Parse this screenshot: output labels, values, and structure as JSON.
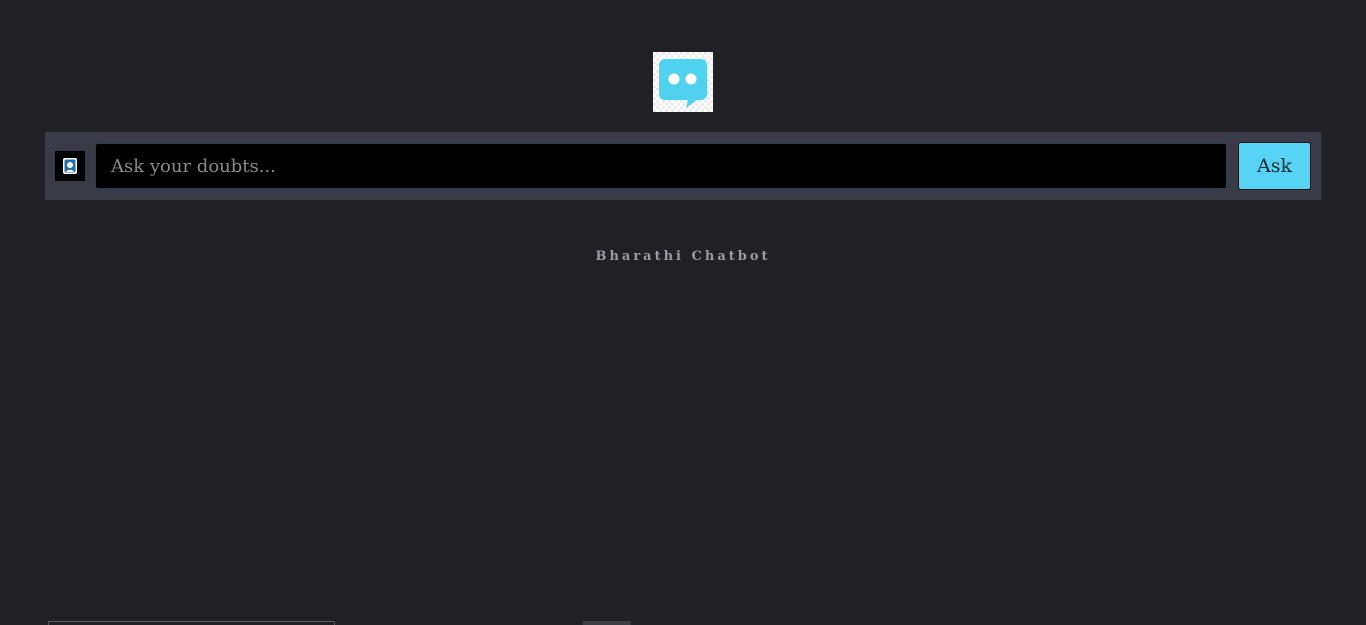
{
  "header": {
    "logo_icon": "chat-bubble-icon"
  },
  "search": {
    "avatar_icon": "user-avatar-icon",
    "placeholder": "Ask your doubts...",
    "value": "",
    "ask_label": "Ask"
  },
  "footer": {
    "tagline": "Bharathi Chatbot"
  },
  "colors": {
    "background": "#202025",
    "bar": "#3b3b48",
    "accent": "#57d3f5",
    "input": "#000000"
  }
}
